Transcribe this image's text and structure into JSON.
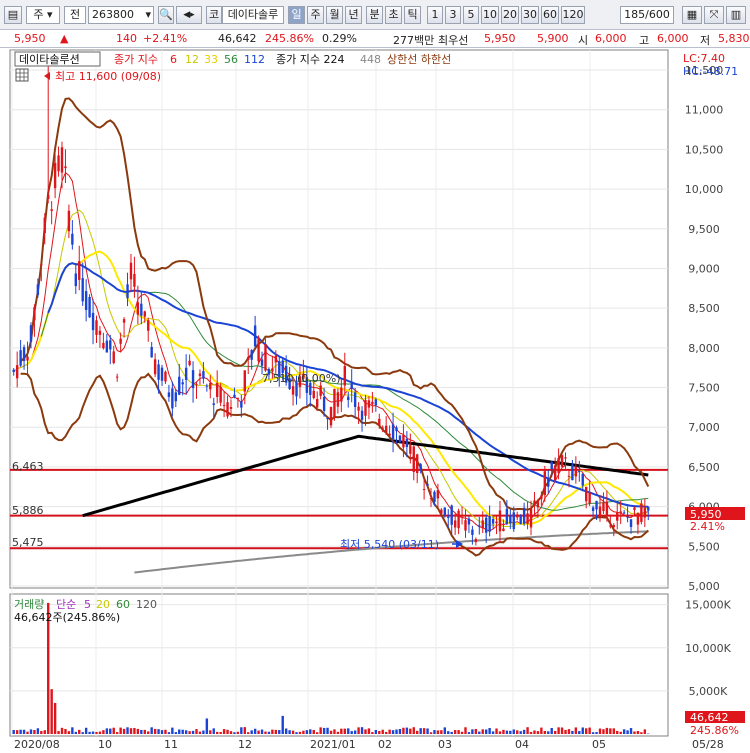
{
  "toolbar": {
    "period_label": "주",
    "type_label": "전",
    "code": "263800",
    "market_label": "코",
    "stock_name": "데이타솔루",
    "timeframes": [
      "일",
      "주",
      "월",
      "년",
      "분",
      "초",
      "틱"
    ],
    "active_timeframe": "일",
    "minute_options": [
      "1",
      "3",
      "5",
      "10",
      "20",
      "30",
      "60",
      "120"
    ],
    "count_display": "185/600"
  },
  "info": {
    "price": "5,950",
    "change": "140",
    "change_pct": "+2.41%",
    "volume": "46,642",
    "volume_pct": "245.86%",
    "turnover_pct": "0.29%",
    "amount": "277백만",
    "bid_label": "최우선",
    "ask": "5,950",
    "bid": "5,900",
    "open_label": "시",
    "open": "6,000",
    "high_label": "고",
    "high": "6,000",
    "low_label": "저",
    "low": "5,830"
  },
  "legend": {
    "name": "데이타솔루션",
    "ma_label": "종가 지수",
    "ma_periods": [
      "6",
      "12",
      "33",
      "56",
      "112"
    ],
    "ma_long_label": "종가 지수 224",
    "ma_long2": "448",
    "band_labels": "상한선 하한선"
  },
  "annotations": {
    "max_label": "최고 11,600 (09/08)",
    "min_label": "최저 5,540 (03/11)",
    "mid_label": "7,510 (0.00%)",
    "lc_label": "LC:7.40",
    "hc_label": "HC:-48.71",
    "level1": "6,463",
    "level2": "5,886",
    "level3": "5,475",
    "current_price": "5,950",
    "current_pct": "2.41%"
  },
  "volume_panel": {
    "legend_label": "거래량",
    "ma_label": "단순",
    "ma_periods": [
      "5",
      "20",
      "60",
      "120"
    ],
    "current_text": "46,642주(245.86%)",
    "current_vol": "46,642",
    "current_pct": "245.86%"
  },
  "colors": {
    "up": "#e0151b",
    "down": "#1a44d6",
    "ma6": "#e0151b",
    "ma12": "#c8c800",
    "ma33": "#ffe800",
    "ma56": "#2f8a3a",
    "ma112": "#1a44d6",
    "ma224": "#000000",
    "ma448": "#8a8a8a",
    "band": "#8b3a0e",
    "levels": "#d4111a"
  },
  "chart_data": {
    "type": "candlestick",
    "ylim": [
      5000,
      11600
    ],
    "y_ticks": [
      "11,500",
      "11,000",
      "10,500",
      "10,000",
      "9,500",
      "9,000",
      "8,500",
      "8,000",
      "7,500",
      "7,000",
      "6,500",
      "6,000",
      "5,500",
      "5,000"
    ],
    "x_ticks": [
      "2020/08",
      "10",
      "11",
      "12",
      "2021/01",
      "02",
      "03",
      "04",
      "05",
      "05/28"
    ],
    "levels": [
      6463,
      5886,
      5475
    ],
    "high": {
      "date": "09/08",
      "value": 11600
    },
    "low": {
      "date": "03/11",
      "value": 5540
    },
    "last_close": 5950,
    "volume_ticks": [
      "15,000K",
      "10,000K",
      "5,000K"
    ],
    "volume_ylim": [
      0,
      16000
    ]
  }
}
